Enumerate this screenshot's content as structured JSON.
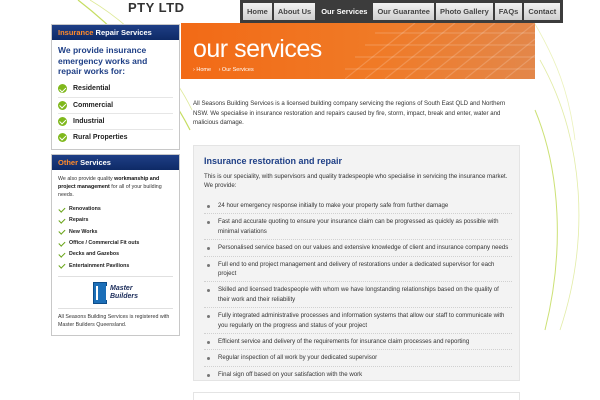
{
  "header": {
    "company": "PTY LTD",
    "nav": [
      {
        "label": "Home",
        "active": false
      },
      {
        "label": "About Us",
        "active": false
      },
      {
        "label": "Our Services",
        "active": true
      },
      {
        "label": "Our Guarantee",
        "active": false
      },
      {
        "label": "Photo Gallery",
        "active": false
      },
      {
        "label": "FAQs",
        "active": false
      },
      {
        "label": "Contact",
        "active": false
      }
    ]
  },
  "sidebar": {
    "repair": {
      "heading_highlight": "Insurance",
      "heading_rest": "Repair Services",
      "intro": "We provide insurance emergency works and repair works for:",
      "items": [
        "Residential",
        "Commercial",
        "Industrial",
        "Rural Properties"
      ]
    },
    "other": {
      "heading_highlight": "Other",
      "heading_rest": "Services",
      "text_pre": "We also provide quality",
      "text_bold1": "workmanship and project management",
      "text_post": "for all of your building needs.",
      "items": [
        "Renovations",
        "Repairs",
        "New Works",
        "Office / Commercial Fit outs",
        "Decks and Gazebos",
        "Entertainment Pavilions"
      ],
      "logo_line1": "Master",
      "logo_line2": "Builders",
      "note": "All Seasons Building Services is registered with Master Builders Queensland."
    }
  },
  "banner": {
    "title": "our services",
    "breadcrumb": [
      "› Home",
      "› Our Services"
    ]
  },
  "main": {
    "intro": "All Seasons Building Services is a licensed building company servicing the regions of South East QLD and Northern NSW. We specialise in insurance restoration and repairs caused by fire, storm, impact, break and enter, water and malicious damage.",
    "panel": {
      "title": "Insurance restoration and repair",
      "text": "This is our speciality, with supervisors and quality tradespeople who specialise in servicing the insurance market. We provide:",
      "items": [
        "24 hour emergency response initially to make your property safe from further damage",
        "Fast and accurate quoting to ensure your insurance claim can be progressed as quickly as possible with minimal variations",
        "Personalised service based on our values and extensive knowledge of client and insurance company needs",
        "Full end to end project management and delivery of restorations under a dedicated supervisor for each project",
        "Skilled and licensed tradespeople with whom we have longstanding relationships based on the quality of their work and their reliability",
        "Fully integrated administrative processes and information systems that allow our staff to communicate with you regularly on the progress and status of your project",
        "Efficient service and delivery of the requirements for insurance claim processes and reporting",
        "Regular inspection of all work by your dedicated supervisor",
        "Final sign off based on your satisfaction with the work"
      ]
    }
  },
  "colors": {
    "navy": "#1e3f86",
    "orange": "#f26a16",
    "green": "#7fb81c"
  }
}
